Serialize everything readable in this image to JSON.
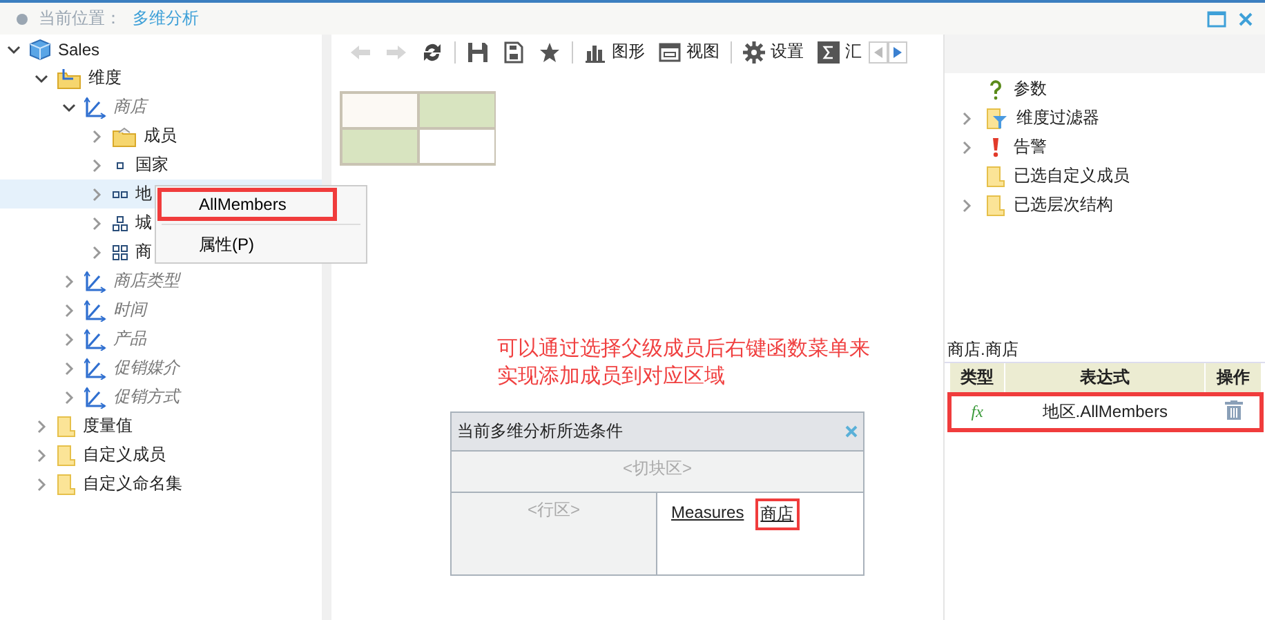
{
  "breadcrumb": {
    "label": "当前位置：",
    "value": "多维分析"
  },
  "window_controls": [
    {
      "kind": "maximize"
    },
    {
      "kind": "close"
    }
  ],
  "tree": [
    {
      "label": "Sales",
      "kind": "cube",
      "expanded": true,
      "selected": false,
      "children": [
        {
          "label": "维度",
          "kind": "dimension-folder",
          "expanded": true,
          "selected": false,
          "children": [
            {
              "label": "商店",
              "kind": "dimension",
              "expanded": true,
              "selected": false,
              "children": [
                {
                  "label": "成员",
                  "kind": "member-folder",
                  "expanded": false,
                  "selected": false
                },
                {
                  "label": "国家",
                  "kind": "level-1",
                  "expanded": false,
                  "selected": false
                },
                {
                  "label": "地",
                  "kind": "level-2",
                  "expanded": false,
                  "selected": true
                },
                {
                  "label": "城",
                  "kind": "level-3",
                  "expanded": false,
                  "selected": false
                },
                {
                  "label": "商",
                  "kind": "level-4",
                  "expanded": false,
                  "selected": false
                }
              ]
            },
            {
              "label": "商店类型",
              "kind": "dimension",
              "expanded": false,
              "selected": false
            },
            {
              "label": "时间",
              "kind": "dimension",
              "expanded": false,
              "selected": false
            },
            {
              "label": "产品",
              "kind": "dimension",
              "expanded": false,
              "selected": false
            },
            {
              "label": "促销媒介",
              "kind": "dimension",
              "expanded": false,
              "selected": false
            },
            {
              "label": "促销方式",
              "kind": "dimension",
              "expanded": false,
              "selected": false
            }
          ]
        },
        {
          "label": "度量值",
          "kind": "folder",
          "expanded": false,
          "selected": false
        },
        {
          "label": "自定义成员",
          "kind": "folder",
          "expanded": false,
          "selected": false
        },
        {
          "label": "自定义命名集",
          "kind": "folder",
          "expanded": false,
          "selected": false
        }
      ]
    }
  ],
  "toolbar": [
    {
      "kind": "back",
      "disabled": true
    },
    {
      "kind": "forward",
      "disabled": true
    },
    {
      "kind": "refresh",
      "disabled": false
    },
    {
      "kind": "separator"
    },
    {
      "kind": "save",
      "disabled": false
    },
    {
      "kind": "save-as",
      "disabled": false
    },
    {
      "kind": "favorite",
      "disabled": false
    },
    {
      "kind": "separator"
    },
    {
      "kind": "chart",
      "label": "图形",
      "disabled": false
    },
    {
      "kind": "view",
      "label": "视图",
      "disabled": false
    },
    {
      "kind": "separator"
    },
    {
      "kind": "settings",
      "label": "设置",
      "disabled": false
    },
    {
      "kind": "sum",
      "label": "汇",
      "disabled": false
    }
  ],
  "context_menu": {
    "items": [
      {
        "label": "AllMembers",
        "annotated": true
      },
      {
        "label": "属性(P)",
        "annotated": false
      }
    ]
  },
  "note": "可以通过选择父级成员后右键函数菜单来实现添加成员到对应区域",
  "condition_panel": {
    "title": "当前多维分析所选条件",
    "slice_placeholder": "<切块区>",
    "row_placeholder": "<行区>",
    "column_items": [
      {
        "label": "Measures",
        "annotated": false
      },
      {
        "label": "商店",
        "annotated": true
      }
    ]
  },
  "right_tree": [
    {
      "label": "参数",
      "kind": "parameter"
    },
    {
      "label": "维度过滤器",
      "kind": "filter",
      "expanded": false
    },
    {
      "label": "告警",
      "kind": "alert",
      "expanded": false
    },
    {
      "label": "已选自定义成员",
      "kind": "folder"
    },
    {
      "label": "已选层次结构",
      "kind": "folder",
      "expanded": false
    }
  ],
  "expression_table": {
    "title": "商店.商店",
    "columns": [
      "类型",
      "表达式",
      "操作"
    ],
    "rows": [
      {
        "type": "fx",
        "expression": "地区.AllMembers",
        "annotated": true
      }
    ]
  }
}
